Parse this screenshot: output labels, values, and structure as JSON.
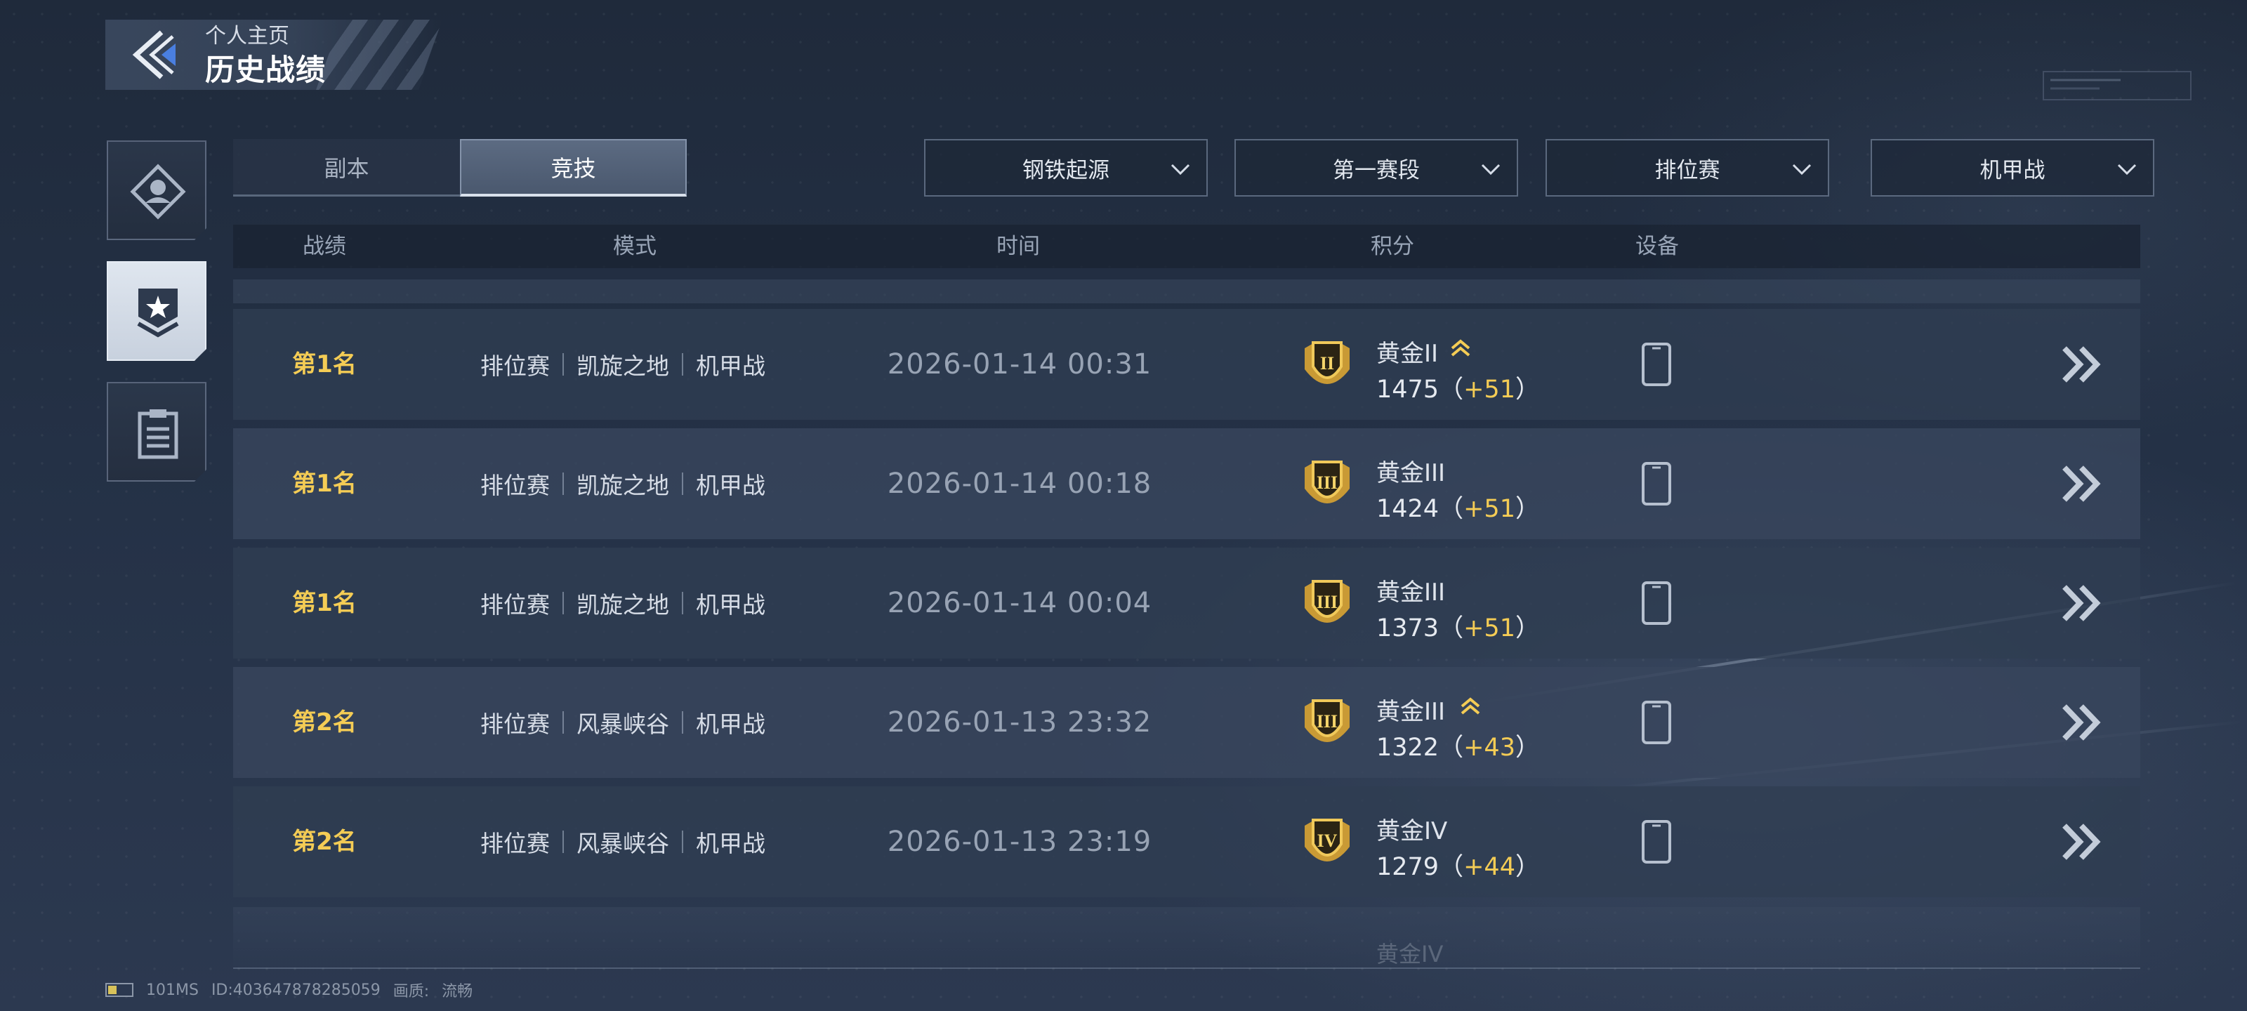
{
  "header": {
    "subtitle": "个人主页",
    "title": "历史战绩"
  },
  "side_nav": [
    {
      "icon": "profile-icon",
      "active": false
    },
    {
      "icon": "medal-icon",
      "active": true
    },
    {
      "icon": "clipboard-icon",
      "active": false
    }
  ],
  "tabs": [
    {
      "label": "副本",
      "active": false
    },
    {
      "label": "竞技",
      "active": true
    }
  ],
  "filters": [
    {
      "label": "钢铁起源"
    },
    {
      "label": "第一赛段"
    },
    {
      "label": "排位赛"
    },
    {
      "label": "机甲战"
    }
  ],
  "columns": {
    "record": "战绩",
    "mode": "模式",
    "time": "时间",
    "score": "积分",
    "device": "设备"
  },
  "rows": [
    {
      "rank": "第1名",
      "mode": [
        "排位赛",
        "凯旋之地",
        "机甲战"
      ],
      "time": "2026-01-14 00:31",
      "tier": "黄金II",
      "tier_numeral": "II",
      "promoted": true,
      "score": "1475",
      "delta": "+51",
      "device": "phone-icon"
    },
    {
      "rank": "第1名",
      "mode": [
        "排位赛",
        "凯旋之地",
        "机甲战"
      ],
      "time": "2026-01-14 00:18",
      "tier": "黄金III",
      "tier_numeral": "III",
      "promoted": false,
      "score": "1424",
      "delta": "+51",
      "device": "phone-icon"
    },
    {
      "rank": "第1名",
      "mode": [
        "排位赛",
        "凯旋之地",
        "机甲战"
      ],
      "time": "2026-01-14 00:04",
      "tier": "黄金III",
      "tier_numeral": "III",
      "promoted": false,
      "score": "1373",
      "delta": "+51",
      "device": "phone-icon"
    },
    {
      "rank": "第2名",
      "mode": [
        "排位赛",
        "风暴峡谷",
        "机甲战"
      ],
      "time": "2026-01-13 23:32",
      "tier": "黄金III",
      "tier_numeral": "III",
      "promoted": true,
      "score": "1322",
      "delta": "+43",
      "device": "phone-icon"
    },
    {
      "rank": "第2名",
      "mode": [
        "排位赛",
        "风暴峡谷",
        "机甲战"
      ],
      "time": "2026-01-13 23:19",
      "tier": "黄金IV",
      "tier_numeral": "IV",
      "promoted": false,
      "score": "1279",
      "delta": "+44",
      "device": "phone-icon"
    }
  ],
  "next_row_partial": {
    "tier": "黄金IV"
  },
  "status_bar": {
    "latency": "101MS",
    "player_id": "ID:403647878285059",
    "quality_label": "画质:",
    "quality_value": "流畅"
  },
  "colors": {
    "accent_gold": "#f4cc55",
    "back_arrow_blue": "#4a7fe0"
  }
}
